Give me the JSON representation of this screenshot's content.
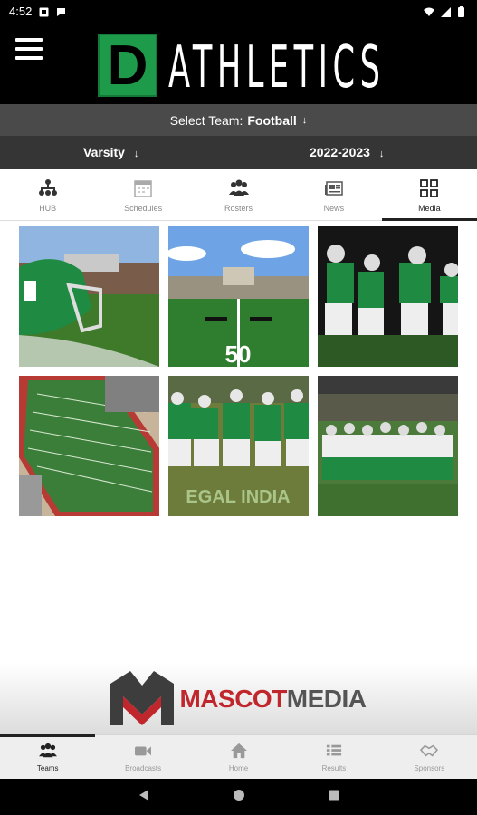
{
  "status_bar": {
    "time": "4:52"
  },
  "header": {
    "logo_letter": "D",
    "logo_text": "ATHLETICS"
  },
  "team_select": {
    "prefix": "Select Team:",
    "team": "Football",
    "arrow": "↓"
  },
  "filters": {
    "level": "Varsity",
    "season": "2022-2023",
    "arrow": "↓"
  },
  "tabs": [
    {
      "label": "HUB",
      "icon": "org-chart-icon"
    },
    {
      "label": "Schedules",
      "icon": "calendar-icon"
    },
    {
      "label": "Rosters",
      "icon": "group-icon"
    },
    {
      "label": "News",
      "icon": "newspaper-icon"
    },
    {
      "label": "Media",
      "icon": "grid-icon",
      "active": true
    }
  ],
  "media": [
    {
      "subject": "helmet-on-field"
    },
    {
      "subject": "50-yard-line"
    },
    {
      "subject": "game-action-night"
    },
    {
      "subject": "stadium-aerial"
    },
    {
      "subject": "team-huddle"
    },
    {
      "subject": "team-run-out"
    }
  ],
  "media_overlay_text": "EGAL INDIA",
  "media_field_number": "50",
  "sponsor": {
    "part1": "MASCOT",
    "part2": "MEDIA"
  },
  "bottom_nav": [
    {
      "label": "Teams",
      "icon": "group-icon",
      "active": true
    },
    {
      "label": "Broadcasts",
      "icon": "video-camera-icon"
    },
    {
      "label": "Home",
      "icon": "home-icon"
    },
    {
      "label": "Results",
      "icon": "list-icon"
    },
    {
      "label": "Sponsors",
      "icon": "handshake-icon"
    }
  ],
  "colors": {
    "brand_green": "#1e9a4b",
    "header_bg": "#000000",
    "team_bar_bg": "#4a4a4a",
    "filter_bg": "#353535",
    "sponsor_red": "#c0272d"
  }
}
